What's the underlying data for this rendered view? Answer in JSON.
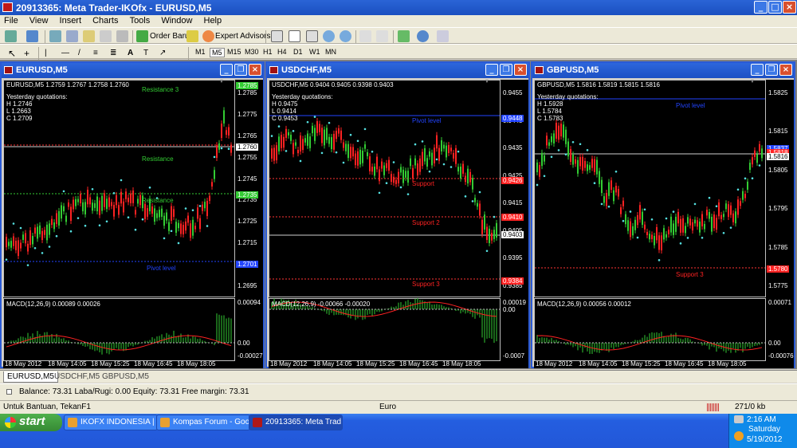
{
  "window": {
    "title": "20913365: Meta Trader-IKOfx - EURUSD,M5"
  },
  "menu": [
    "File",
    "View",
    "Insert",
    "Charts",
    "Tools",
    "Window",
    "Help"
  ],
  "toolbar": {
    "order_label": "Order Baru",
    "expert_label": "Expert Advisors",
    "timeframes": [
      "M1",
      "M5",
      "M15",
      "M30",
      "H1",
      "H4",
      "D1",
      "W1",
      "MN"
    ],
    "active_timeframe": "M5"
  },
  "charts": [
    {
      "window_title": "EURUSD,M5",
      "info": "EURUSD,M5  1.2759 1.2767 1.2758 1.2760",
      "yq": [
        "Yesterday quotations:",
        "H 1.2746",
        "L 1.2663",
        "C 1.2709"
      ],
      "prices": [
        "1.2785",
        "1.2775",
        "1.2765",
        "1.2755",
        "1.2745",
        "1.2735",
        "1.2725",
        "1.2715",
        "1.2705",
        "1.2695"
      ],
      "markers": [
        {
          "text": "1.2785",
          "color": "#33cc33"
        },
        {
          "text": "1.2760",
          "color": "#ffffff"
        },
        {
          "text": "1.2735",
          "color": "#33cc33"
        },
        {
          "text": "1.2701",
          "color": "#2244ff"
        }
      ],
      "levels": [
        {
          "text": "Resistance 3",
          "color": "#33cc33"
        },
        {
          "text": "Resistance",
          "color": "#33cc33"
        },
        {
          "text": "Resistance",
          "color": "#33cc33"
        },
        {
          "text": "Pivot level",
          "color": "#2244ff"
        }
      ],
      "macd_label": "MACD(12,26,9) 0.00089 0.00026",
      "macd_scale": [
        "0.00094",
        "0.00",
        "-0.00027"
      ],
      "times": [
        "18 May 2012",
        "18 May 14:05",
        "18 May 15:25",
        "18 May 16:45",
        "18 May 18:05"
      ]
    },
    {
      "window_title": "USDCHF,M5",
      "info": "USDCHF,M5  0.9404 0.9405 0.9398 0.9403",
      "yq": [
        "Yesterday quotations:",
        "H 0.9475",
        "L 0.9414",
        "C 0.9453"
      ],
      "prices": [
        "0.9455",
        "0.9445",
        "0.9435",
        "0.9425",
        "0.9415",
        "0.9405",
        "0.9395",
        "0.9385"
      ],
      "markers": [
        {
          "text": "0.9448",
          "color": "#2244ff"
        },
        {
          "text": "0.9426",
          "color": "#ff2222"
        },
        {
          "text": "0.9410",
          "color": "#ff2222"
        },
        {
          "text": "0.9403",
          "color": "#ffffff"
        },
        {
          "text": "0.9384",
          "color": "#ff2222"
        }
      ],
      "levels": [
        {
          "text": "Pivot level",
          "color": "#2244ff"
        },
        {
          "text": "Support",
          "color": "#ff2222"
        },
        {
          "text": "Support 2",
          "color": "#ff2222"
        },
        {
          "text": "Support 3",
          "color": "#ff2222"
        }
      ],
      "macd_label": "MACD(12,26,9) -0.00066 -0.00020",
      "macd_scale": [
        "0.00019",
        "0.00",
        "-0.0007"
      ],
      "times": [
        "18 May 2012",
        "18 May 14:05",
        "18 May 15:25",
        "18 May 16:45",
        "18 May 18:05"
      ]
    },
    {
      "window_title": "GBPUSD,M5",
      "info": "GBPUSD,M5  1.5816 1.5819 1.5815 1.5816",
      "yq": [
        "Yesterday quotations:",
        "H 1.5928",
        "L 1.5784",
        "C 1.5783"
      ],
      "prices": [
        "1.5825",
        "1.5815",
        "1.5805",
        "1.5795",
        "1.5785",
        "1.5775"
      ],
      "markers": [
        {
          "text": "1.5837",
          "color": "#2244ff"
        },
        {
          "text": "1.5818",
          "color": "#ff2222"
        },
        {
          "text": "1.5816",
          "color": "#ffffff"
        },
        {
          "text": "1.5780",
          "color": "#ff2222"
        }
      ],
      "levels": [
        {
          "text": "Pivot level",
          "color": "#2244ff"
        },
        {
          "text": "Support 3",
          "color": "#ff2222"
        }
      ],
      "macd_label": "MACD(12,26,9) 0.00056 0.00012",
      "macd_scale": [
        "0.00071",
        "0.00",
        "-0.00076"
      ],
      "times": [
        "18 May 2012",
        "18 May 14:05",
        "18 May 15:25",
        "18 May 16:45",
        "18 May 18:05"
      ]
    }
  ],
  "tabs": [
    "EURUSD,M5",
    "USDCHF,M5",
    "GBPUSD,M5"
  ],
  "terminal": {
    "summary": "Balance: 73.31  Laba/Rugi: 0.00  Equity: 73.31  Free margin: 73.31"
  },
  "status": {
    "help": "Untuk Bantuan, TekanF1",
    "profile": "Euro",
    "traffic": "271/0 kb"
  },
  "taskbar": {
    "start": "start",
    "tasks": [
      "IKOFX INDONESIA | I...",
      "Kompas Forum - Goo...",
      "20913365: Meta Trad..."
    ]
  },
  "clock": {
    "time": "2:16 AM",
    "day": "Saturday",
    "date": "5/19/2012"
  },
  "colors": {
    "bull": "#33cc33",
    "bear": "#ff2222",
    "sar": "#55e0e0",
    "pivot": "#2244ff"
  }
}
